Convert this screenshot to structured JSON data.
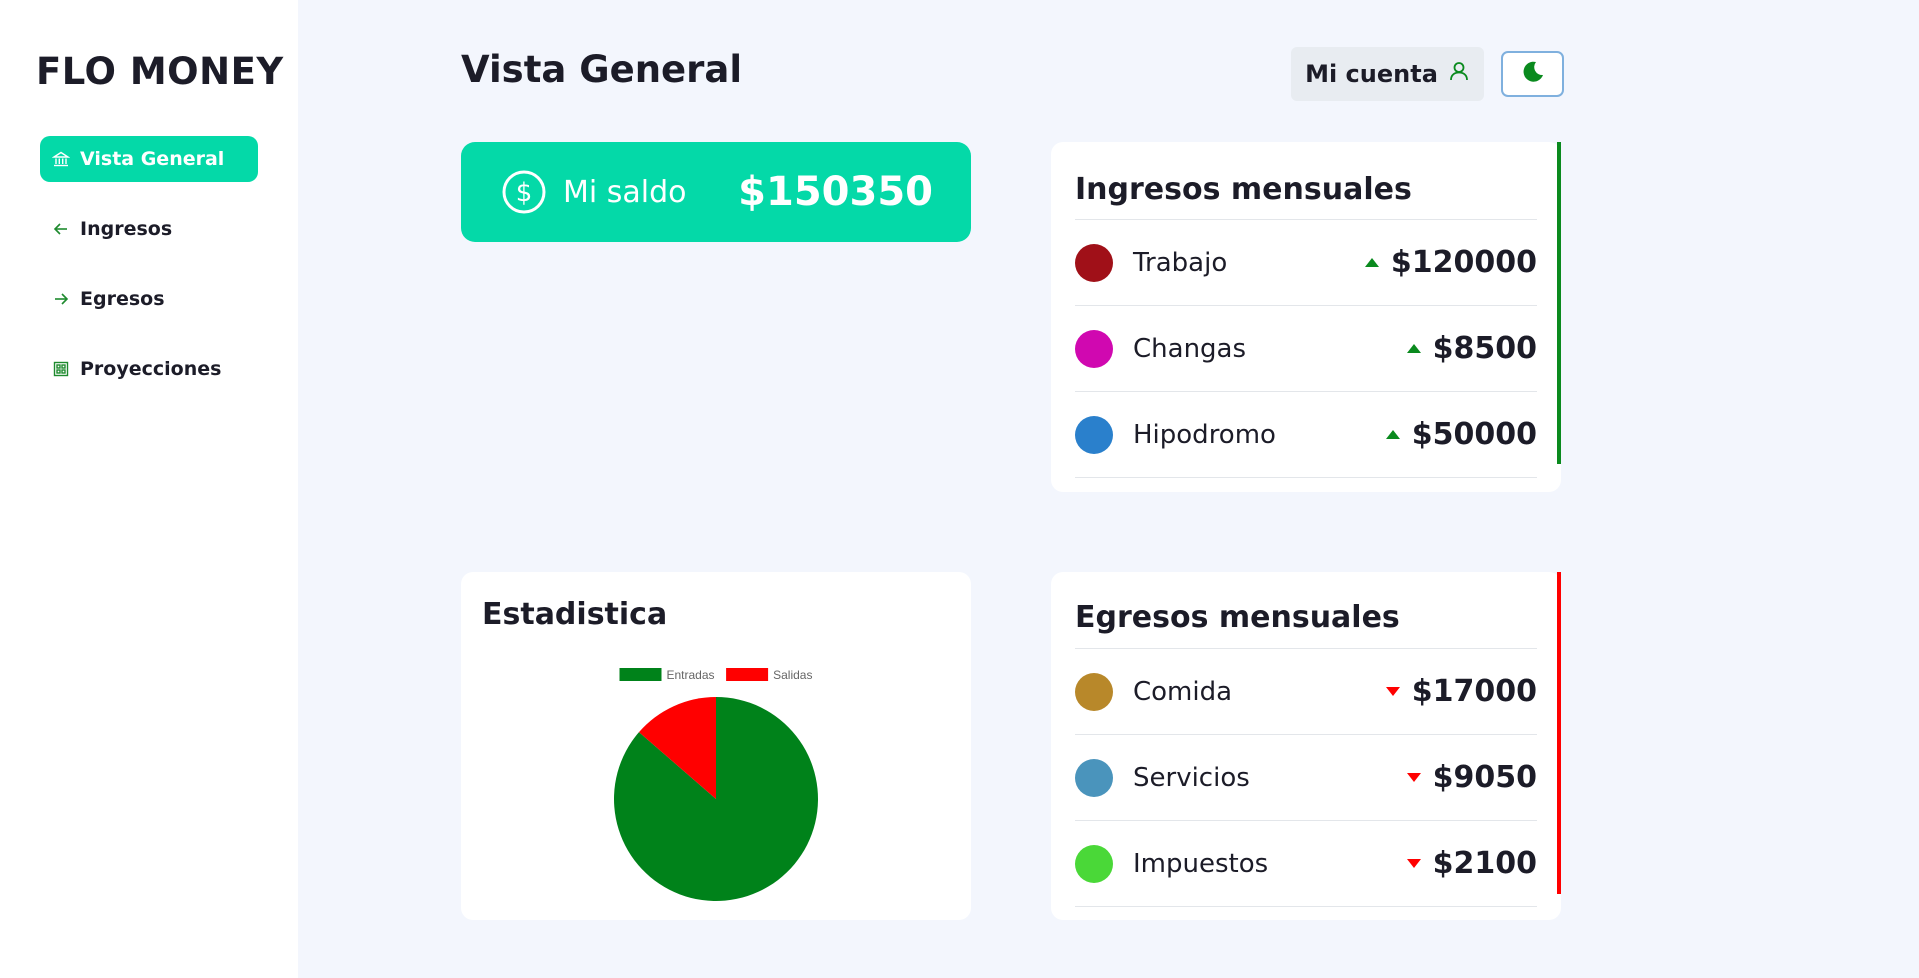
{
  "app": {
    "brand": "FLO MONEY"
  },
  "sidebar": {
    "items": [
      {
        "label": "Vista General",
        "icon": "bank-icon",
        "active": true
      },
      {
        "label": "Ingresos",
        "icon": "arrow-left-icon",
        "active": false
      },
      {
        "label": "Egresos",
        "icon": "arrow-right-icon",
        "active": false
      },
      {
        "label": "Proyecciones",
        "icon": "grid-icon",
        "active": false
      }
    ]
  },
  "header": {
    "title": "Vista General",
    "account_label": "Mi cuenta",
    "account_icon": "user-icon",
    "theme_icon": "moon-icon"
  },
  "balance": {
    "label": "Mi saldo",
    "value": "$150350",
    "icon": "dollar-circle-icon"
  },
  "income": {
    "title": "Ingresos mensuales",
    "accent_color": "#0a8a1e",
    "items": [
      {
        "label": "Trabajo",
        "value": "$120000",
        "color": "#a01018"
      },
      {
        "label": "Changas",
        "value": "$8500",
        "color": "#d008b0"
      },
      {
        "label": "Hipodromo",
        "value": "$50000",
        "color": "#2a80cc"
      }
    ]
  },
  "expenses": {
    "title": "Egresos mensuales",
    "accent_color": "#ff0000",
    "items": [
      {
        "label": "Comida",
        "value": "$17000",
        "color": "#b8882a"
      },
      {
        "label": "Servicios",
        "value": "$9050",
        "color": "#4a94bc"
      },
      {
        "label": "Impuestos",
        "value": "$2100",
        "color": "#4ad838"
      }
    ]
  },
  "stats": {
    "title": "Estadistica"
  },
  "chart_data": {
    "type": "pie",
    "title": "",
    "legend_position": "top",
    "series": [
      {
        "name": "Entradas",
        "value": 178500,
        "color": "#00821a"
      },
      {
        "name": "Salidas",
        "value": 28150,
        "color": "#ff0000"
      }
    ]
  }
}
